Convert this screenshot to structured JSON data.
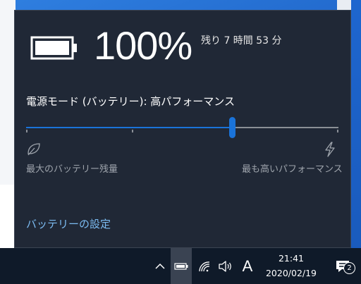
{
  "battery": {
    "percent_text": "100%",
    "level": 1.0,
    "remaining_text": "残り 7 時間 53 分"
  },
  "power_mode": {
    "label": "電源モード (バッテリー): 高パフォーマンス",
    "slider_value": 0.66,
    "left_label": "最大のバッテリー残量",
    "right_label": "最も高いパフォーマンス"
  },
  "settings_link": "バッテリーの設定",
  "taskbar": {
    "ime_indicator": "A",
    "time": "21:41",
    "date": "2020/02/19",
    "notification_count": "2"
  },
  "colors": {
    "accent": "#1a73d9",
    "link": "#7cbcf2",
    "flyout_bg": "#202836",
    "taskbar_bg": "#0f1a29"
  },
  "icons": [
    "battery-icon",
    "leaf-icon",
    "lightning-icon",
    "chevron-up-icon",
    "wifi-icon",
    "speaker-icon",
    "action-center-icon"
  ]
}
